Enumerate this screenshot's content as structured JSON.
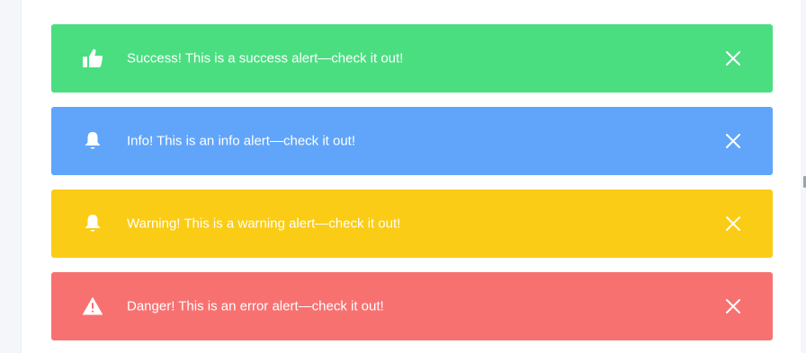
{
  "alerts": [
    {
      "type": "success",
      "message": "Success! This is a success alert—check it out!",
      "icon": "thumbs-up-icon",
      "color": "#4ade80"
    },
    {
      "type": "info",
      "message": "Info! This is an info alert—check it out!",
      "icon": "bell-icon",
      "color": "#60a5fa"
    },
    {
      "type": "warning",
      "message": "Warning! This is a warning alert—check it out!",
      "icon": "bell-icon",
      "color": "#facc15"
    },
    {
      "type": "danger",
      "message": "Danger! This is an error alert—check it out!",
      "icon": "warning-triangle-icon",
      "color": "#f87171"
    }
  ]
}
